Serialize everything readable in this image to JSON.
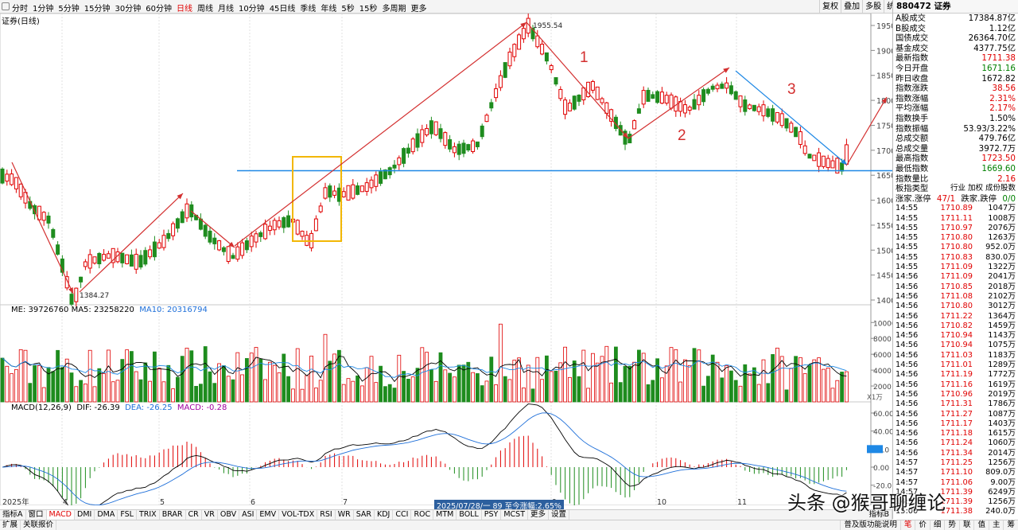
{
  "toolbar": {
    "periods": [
      "分时",
      "1分钟",
      "5分钟",
      "15分钟",
      "30分钟",
      "60分钟",
      "日线",
      "周线",
      "月线",
      "10分钟",
      "45日线",
      "季线",
      "年线",
      "5秒",
      "15秒",
      "多周期",
      "更多"
    ],
    "active": "日线",
    "right": [
      "复权",
      "叠加",
      "多股",
      "统计",
      "画线",
      "F10",
      "标记",
      "+自选",
      "返回"
    ]
  },
  "chart": {
    "title": "证券(日线)",
    "ma_label": "ME: 39726760  MA5: 23258220",
    "ma10_label": "MA10: 20316794",
    "macd_label": "MACD(12,26,9)",
    "dif": "DIF: -26.39",
    "dea": "DEA: -26.25",
    "macd": "MACD: -0.28",
    "price_ticks": [
      "1950",
      "1900",
      "1850",
      "1800",
      "1750",
      "1700",
      "1650",
      "1600",
      "1550",
      "1500",
      "1450",
      "1400"
    ],
    "vol_ticks": [
      "10000",
      "8000",
      "6000",
      "4000",
      "2000"
    ],
    "vol_unit": "X1万",
    "macd_ticks": [
      "60.00",
      "40.00",
      "20.0",
      "0.00",
      "-20.0"
    ],
    "high_label": "1955.54",
    "low_label": "1384.27",
    "x_labels": [
      "2025年",
      "4",
      "5",
      "6",
      "7",
      "9",
      "10",
      "11"
    ],
    "date_label": "2025/07/28/一 89 至今涨幅:2.65%",
    "anno": [
      "1",
      "2",
      "3"
    ],
    "colors": {
      "up": "#e00000",
      "down": "#1e8c1e",
      "blue": "#1e88e5",
      "arrow": "#d32f2f",
      "box": "#f2b705",
      "dea": "#1e6fd9",
      "dif": "#000000"
    }
  },
  "chart_data": {
    "type": "candlestick",
    "title": "证券(日线)",
    "ylim": [
      1370,
      1965
    ],
    "support": 1659,
    "high": 1955.54,
    "low": 1384.27
  },
  "side": {
    "code": "880472 证券",
    "rows": [
      {
        "l": "A股成交",
        "v": "17384.87亿",
        "c": "bl"
      },
      {
        "l": "B股成交",
        "v": "1.12亿",
        "c": "bl"
      },
      {
        "l": "国债成交",
        "v": "26364.70亿",
        "c": "bl"
      },
      {
        "l": "基金成交",
        "v": "4377.75亿",
        "c": "bl"
      },
      {
        "l": "最新指数",
        "v": "1711.38",
        "c": "up"
      },
      {
        "l": "今日开盘",
        "v": "1671.16",
        "c": "down"
      },
      {
        "l": "昨日收盘",
        "v": "1672.82",
        "c": "bl"
      },
      {
        "l": "指数涨跌",
        "v": "38.56",
        "c": "up"
      },
      {
        "l": "指数涨幅",
        "v": "2.31%",
        "c": "up"
      },
      {
        "l": "平均涨幅",
        "v": "2.17%",
        "c": "up"
      },
      {
        "l": "指数换手",
        "v": "1.50%",
        "c": "bl"
      },
      {
        "l": "指数振幅",
        "v": "53.93/3.22%",
        "c": "bl"
      },
      {
        "l": "总成交额",
        "v": "479.76亿",
        "c": "bl"
      },
      {
        "l": "总成交量",
        "v": "3972.7万",
        "c": "bl"
      },
      {
        "l": "最高指数",
        "v": "1723.50",
        "c": "up"
      },
      {
        "l": "最低指数",
        "v": "1669.60",
        "c": "down"
      },
      {
        "l": "指数量比",
        "v": "2.16",
        "c": "up"
      }
    ],
    "type_label": "板指类型",
    "type_value": "行业 加权 成份股数",
    "updown_label": "涨家.涨停",
    "updown_value": "47/1",
    "fall_label": "跌家.跌停",
    "fall_value": "0/0",
    "ticks": [
      [
        "14:55",
        "1710.89",
        "1047万"
      ],
      [
        "14:55",
        "1711.11",
        "1008万"
      ],
      [
        "14:55",
        "1710.97",
        "2076万"
      ],
      [
        "14:55",
        "1710.80",
        "1263万"
      ],
      [
        "14:55",
        "1710.80",
        "952.0万"
      ],
      [
        "14:55",
        "1710.83",
        "830.0万"
      ],
      [
        "14:55",
        "1711.09",
        "1322万"
      ],
      [
        "14:56",
        "1711.09",
        "2041万"
      ],
      [
        "14:56",
        "1710.85",
        "2018万"
      ],
      [
        "14:56",
        "1711.08",
        "2102万"
      ],
      [
        "14:56",
        "1710.80",
        "3012万"
      ],
      [
        "14:56",
        "1711.22",
        "1364万"
      ],
      [
        "14:56",
        "1710.82",
        "1459万"
      ],
      [
        "14:56",
        "1710.94",
        "1143万"
      ],
      [
        "14:56",
        "1710.94",
        "1075万"
      ],
      [
        "14:56",
        "1711.03",
        "1183万"
      ],
      [
        "14:56",
        "1711.01",
        "1289万"
      ],
      [
        "14:56",
        "1711.19",
        "1772万"
      ],
      [
        "14:56",
        "1711.16",
        "1619万"
      ],
      [
        "14:56",
        "1710.96",
        "2019万"
      ],
      [
        "14:56",
        "1711.31",
        "1786万"
      ],
      [
        "14:56",
        "1711.27",
        "1087万"
      ],
      [
        "14:56",
        "1711.17",
        "1403万"
      ],
      [
        "14:56",
        "1711.18",
        "1615万"
      ],
      [
        "14:56",
        "1711.24",
        "1060万"
      ],
      [
        "14:56",
        "1711.34",
        "2014万"
      ],
      [
        "14:57",
        "1711.25",
        "1256万"
      ],
      [
        "14:57",
        "1711.10",
        "809.0万"
      ],
      [
        "14:57",
        "1711.06",
        "9.00万"
      ],
      [
        "14:57",
        "1711.39",
        "6249万"
      ],
      [
        "14:57",
        "1711.39",
        "1256万"
      ],
      [
        "15:00",
        "1711.38",
        "240.0万"
      ]
    ]
  },
  "bottom1": [
    "指标A",
    "窗口",
    "MACD",
    "DMI",
    "DMA",
    "FSL",
    "TRIX",
    "BRAR",
    "CR",
    "VR",
    "OBV",
    "ASI",
    "EMV",
    "VOL-TDX",
    "RSI",
    "WR",
    "SAR",
    "KDJ",
    "CCI",
    "ROC",
    "MTM",
    "BOLL",
    "PSY",
    "MCST",
    "更多",
    "设置"
  ],
  "bottom1_active": "MACD",
  "bottom1_right": "指标B",
  "bottom2": {
    "left": [
      "扩展",
      "关联报价"
    ],
    "right_text": "普及版功能说明",
    "right_btns": [
      "笔",
      "价",
      "细",
      "势",
      "联",
      "值",
      "主",
      "筹"
    ]
  },
  "watermark": "头条 @猴哥聊缠论"
}
